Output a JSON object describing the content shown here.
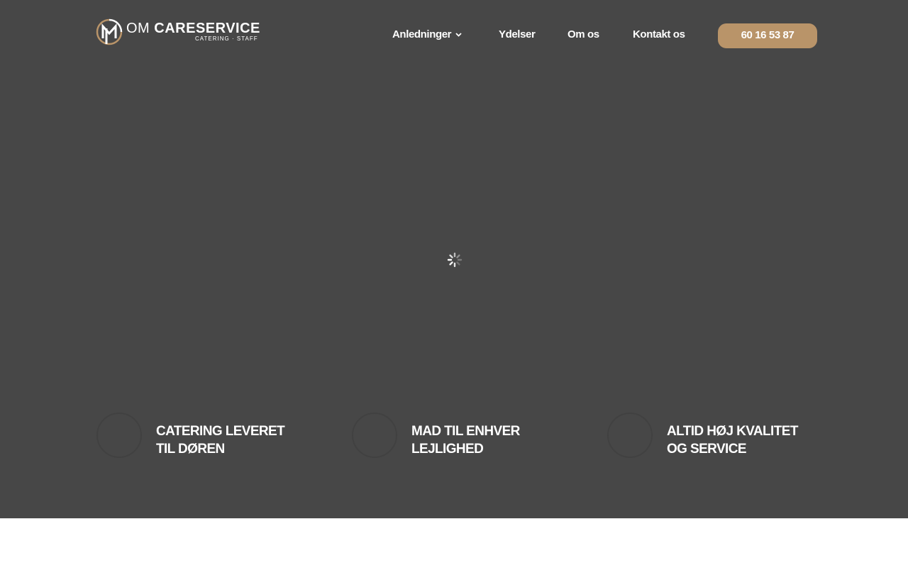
{
  "brand": {
    "name_light": "OM",
    "name_bold": "CARESERVICE",
    "tagline": "CATERING · STAFF",
    "accent_color": "#b99469"
  },
  "nav": {
    "items": [
      {
        "label": "Anledninger",
        "has_dropdown": true
      },
      {
        "label": "Ydelser"
      },
      {
        "label": "Om os"
      },
      {
        "label": "Kontakt os"
      }
    ],
    "phone_label": "60 16 53 87"
  },
  "hero": {
    "background_color": "#474747",
    "loading_icon": "spinner-icon"
  },
  "features": [
    {
      "title": "CATERING LEVERET TIL DØREN",
      "icon": "delivery-icon"
    },
    {
      "title": "MAD TIL ENHVER LEJLIGHED",
      "icon": "food-icon"
    },
    {
      "title": "ALTID HØJ KVALITET OG SERVICE",
      "icon": "quality-icon"
    }
  ]
}
